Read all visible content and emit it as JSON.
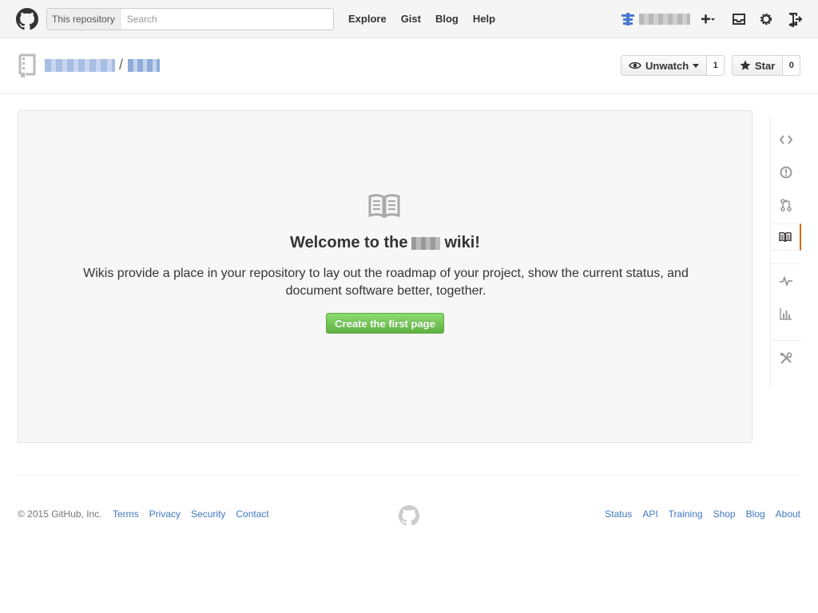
{
  "header": {
    "search_scope": "This repository",
    "search_placeholder": "Search",
    "nav": [
      "Explore",
      "Gist",
      "Blog",
      "Help"
    ]
  },
  "repo": {
    "separator": "/",
    "watch_label": "Unwatch",
    "watch_count": "1",
    "star_label": "Star",
    "star_count": "0"
  },
  "wiki": {
    "title_prefix": "Welcome to the",
    "title_suffix": "wiki!",
    "description": "Wikis provide a place in your repository to lay out the roadmap of your project, show the current status, and document software better, together.",
    "create_button": "Create the first page"
  },
  "sidenav": {
    "items": [
      "code-icon",
      "issues-icon",
      "pull-requests-icon",
      "wiki-icon",
      "pulse-icon",
      "graphs-icon",
      "settings-icon"
    ],
    "selected": "wiki-icon",
    "accent_color": "#d26911"
  },
  "footer": {
    "copyright": "© 2015 GitHub, Inc.",
    "left_links": [
      "Terms",
      "Privacy",
      "Security",
      "Contact"
    ],
    "right_links": [
      "Status",
      "API",
      "Training",
      "Shop",
      "Blog",
      "About"
    ]
  },
  "colors": {
    "link": "#4078c0",
    "create_button": "#60b044"
  }
}
